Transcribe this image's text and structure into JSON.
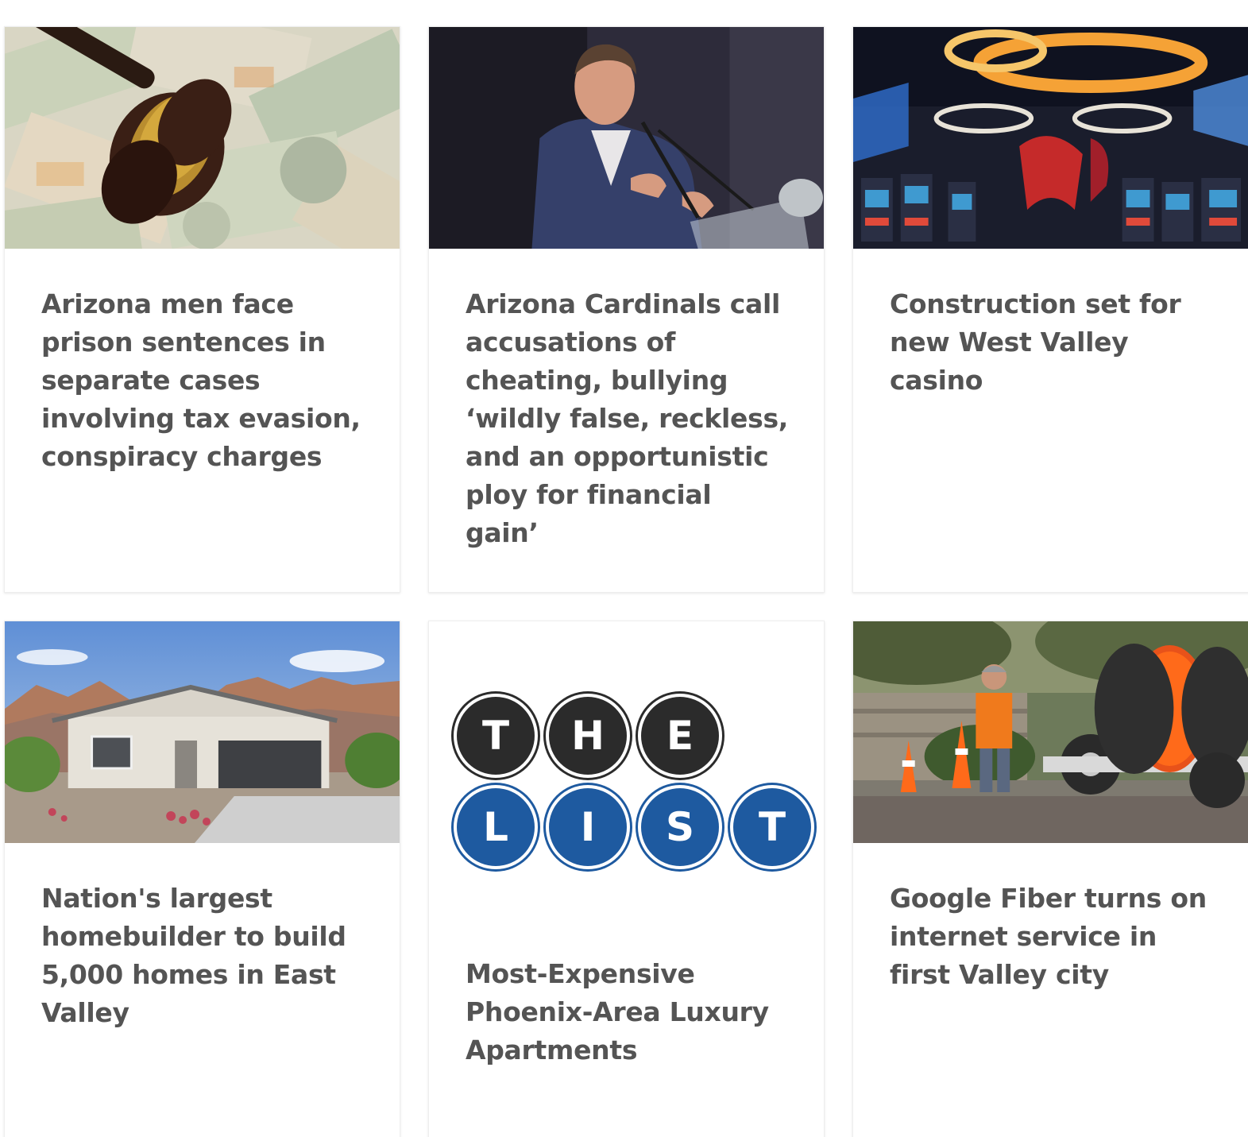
{
  "articles": [
    {
      "headline": "Arizona men face prison sentences in separate cases involving tax evasion, conspiracy charges",
      "image": "gavel-on-money-photo"
    },
    {
      "headline": "Arizona Cardinals call accusations of cheating, bullying ‘wildly false, reckless, and an opportunistic ploy for financial gain’",
      "image": "speaker-at-podium-photo"
    },
    {
      "headline": "Construction set for new West Valley casino",
      "image": "casino-floor-photo"
    },
    {
      "headline": "Nation's largest homebuilder to build 5,000 homes in East Valley",
      "image": "desert-house-photo"
    },
    {
      "headline": "Most-Expensive Phoenix-Area Luxury Apartments",
      "image": "the-list-logo",
      "logo_row1": [
        "T",
        "H",
        "E"
      ],
      "logo_row2": [
        "L",
        "I",
        "S",
        "T"
      ]
    },
    {
      "headline": "Google Fiber turns on internet service in first Valley city",
      "image": "fiber-cable-worker-photo"
    }
  ],
  "colors": {
    "headline_text": "#545454",
    "list_dark": "#2b2b2b",
    "list_blue": "#1e5aa0"
  }
}
